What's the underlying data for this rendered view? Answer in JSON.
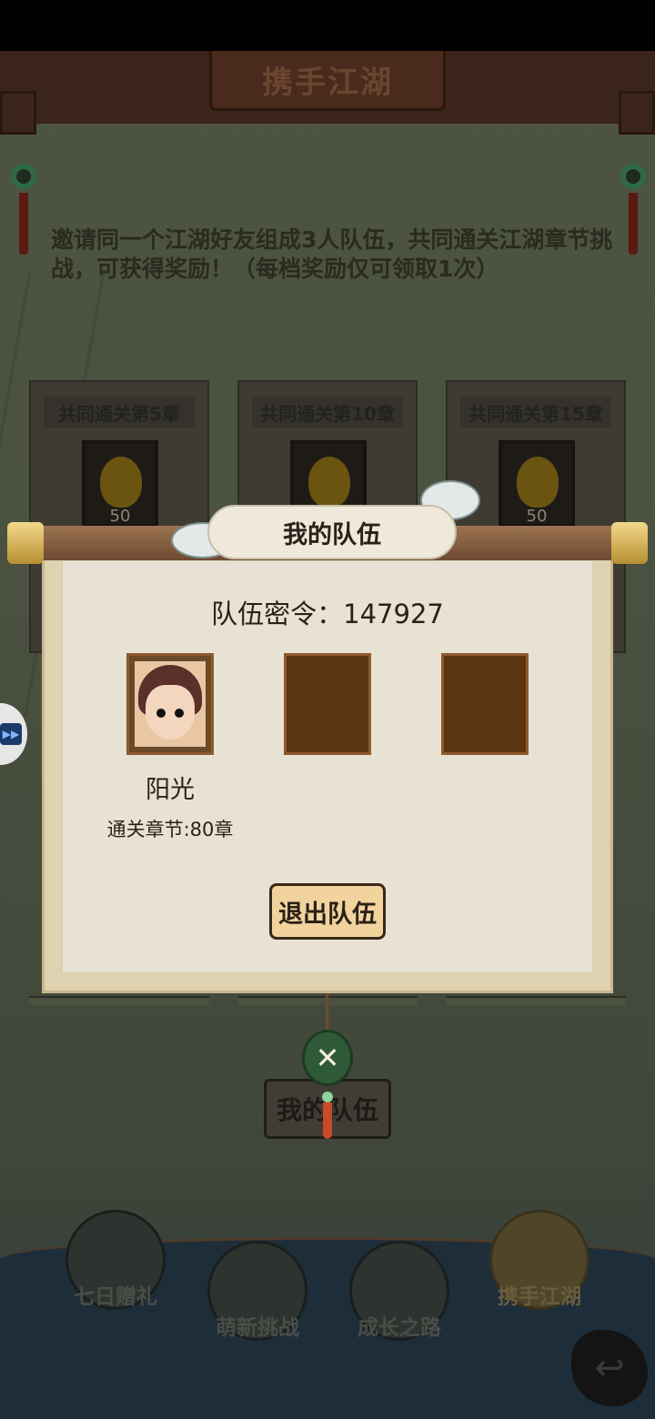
{
  "header": {
    "title": "携手江湖"
  },
  "intro": {
    "text": "邀请同一个江湖好友组成3人队伍，共同通关江湖章节挑战，可获得奖励！（每档奖励仅可领取1次）"
  },
  "rewards": [
    {
      "title": "共同通关第5章",
      "count": "50",
      "icon": "gourd-icon"
    },
    {
      "title": "共同通关第10章",
      "count": "50",
      "icon": "gourd-icon"
    },
    {
      "title": "共同通关第15章",
      "count": "50",
      "icon": "gourd-icon"
    }
  ],
  "modal": {
    "title": "我的队伍",
    "team_code_label": "队伍密令：147927",
    "members": [
      {
        "name": "阳光",
        "progress": "通关章节:80章"
      }
    ],
    "leave_button": "退出队伍",
    "close_icon": "close-icon"
  },
  "background_team_button": "我的队伍",
  "bottom_nav": [
    {
      "label": "七日赠礼",
      "icon": "gift-box-icon"
    },
    {
      "label": "萌新挑战",
      "icon": "mascot-icon"
    },
    {
      "label": "成长之路",
      "icon": "book-arrow-icon"
    },
    {
      "label": "携手江湖",
      "icon": "handshake-icon"
    }
  ],
  "colors": {
    "panel_bg": "#e7e2d3",
    "button_bg": "#f2d39e",
    "slot_bg": "#5c3512",
    "close_button": "#2f5a38"
  }
}
